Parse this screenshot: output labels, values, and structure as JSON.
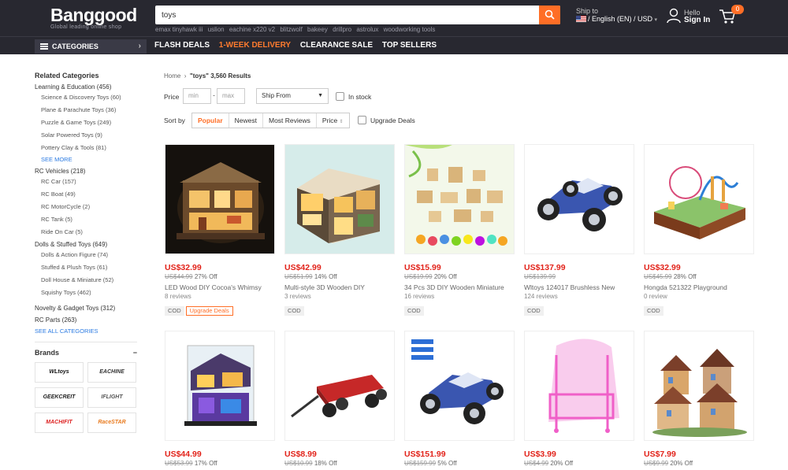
{
  "header": {
    "logo": "Banggood",
    "tagline": "Global leading online shop",
    "search_value": "toys",
    "hotwords": [
      "emax tinyhawk iii",
      "uslion",
      "eachine x220 v2",
      "blitzwolf",
      "bakeey",
      "drillpro",
      "astrolux",
      "woodworking tools"
    ],
    "ship_to": "Ship to",
    "language": "/ English (EN) / USD",
    "hello": "Hello",
    "signin": "Sign In",
    "cart_count": "0",
    "accent": "#ff6e26"
  },
  "nav": {
    "categories": "CATEGORIES",
    "links": [
      "FLASH DEALS",
      "1-WEEK DELIVERY",
      "CLEARANCE SALE",
      "TOP SELLERS"
    ]
  },
  "sidebar": {
    "title": "Related Categories",
    "groups": [
      {
        "label": "Learning & Education (456)",
        "items": [
          "Science & Discovery Toys (60)",
          "Plane & Parachute Toys (36)",
          "Puzzle & Game Toys (249)",
          "Solar Powered Toys (9)",
          "Pottery Clay & Tools (81)"
        ],
        "more": "SEE MORE"
      },
      {
        "label": "RC Vehicles (218)",
        "items": [
          "RC Car (157)",
          "RC Boat (49)",
          "RC MotorCycle (2)",
          "RC Tank (5)",
          "Ride On Car (5)"
        ]
      },
      {
        "label": "Dolls & Stuffed Toys (649)",
        "items": [
          "Dolls & Action Figure (74)",
          "Stuffed & Plush Toys (61)",
          "Doll House & Miniature (52)",
          "Squishy Toys (462)"
        ]
      },
      {
        "label": "Novelty & Gadget Toys (312)",
        "items": []
      },
      {
        "label": "RC Parts (263)",
        "items": []
      }
    ],
    "see_all": "SEE ALL CATEGORIES",
    "brands_title": "Brands",
    "brands": [
      "WLtoys",
      "EACHINE",
      "GEEKCREIT",
      "IFLIGHT",
      "MACHIFIT",
      "RaceSTAR"
    ]
  },
  "breadcrumb": {
    "home": "Home",
    "query": "\"toys\"",
    "results": "3,560 Results"
  },
  "filters": {
    "price_label": "Price",
    "min_placeholder": "min",
    "max_placeholder": "max",
    "ship_from": "Ship From",
    "in_stock": "In stock",
    "sort_label": "Sort by",
    "sort_options": [
      "Popular",
      "Newest",
      "Most Reviews",
      "Price"
    ],
    "upgrade_deals": "Upgrade Deals"
  },
  "products": [
    {
      "price": "US$32.99",
      "orig": "US$44.99",
      "off": "27% Off",
      "title": "LED Wood DIY Cocoa's Whimsy",
      "reviews": "8 reviews",
      "tags": [
        "COD",
        "Upgrade Deals"
      ]
    },
    {
      "price": "US$42.99",
      "orig": "US$51.99",
      "off": "14% Off",
      "title": "Multi-style 3D Wooden DIY",
      "reviews": "3 reviews",
      "tags": [
        "COD"
      ]
    },
    {
      "price": "US$15.99",
      "orig": "US$19.99",
      "off": "20% Off",
      "title": "34 Pcs 3D DIY Wooden Miniature",
      "reviews": "16 reviews",
      "tags": [
        "COD"
      ]
    },
    {
      "price": "US$137.99",
      "orig": "US$139.99",
      "off": "",
      "title": "Wltoys 124017 Brushless New",
      "reviews": "124 reviews",
      "tags": [
        "COD"
      ]
    },
    {
      "price": "US$32.99",
      "orig": "US$45.99",
      "off": "28% Off",
      "title": "Hongda 521322 Playground",
      "reviews": "0 review",
      "tags": [
        "COD"
      ]
    },
    {
      "price": "US$44.99",
      "orig": "US$53.99",
      "off": "17% Off"
    },
    {
      "price": "US$8.99",
      "orig": "US$10.99",
      "off": "18% Off"
    },
    {
      "price": "US$151.99",
      "orig": "US$159.99",
      "off": "5% Off"
    },
    {
      "price": "US$3.99",
      "orig": "US$4.99",
      "off": "20% Off"
    },
    {
      "price": "US$7.99",
      "orig": "US$9.99",
      "off": "20% Off"
    }
  ]
}
